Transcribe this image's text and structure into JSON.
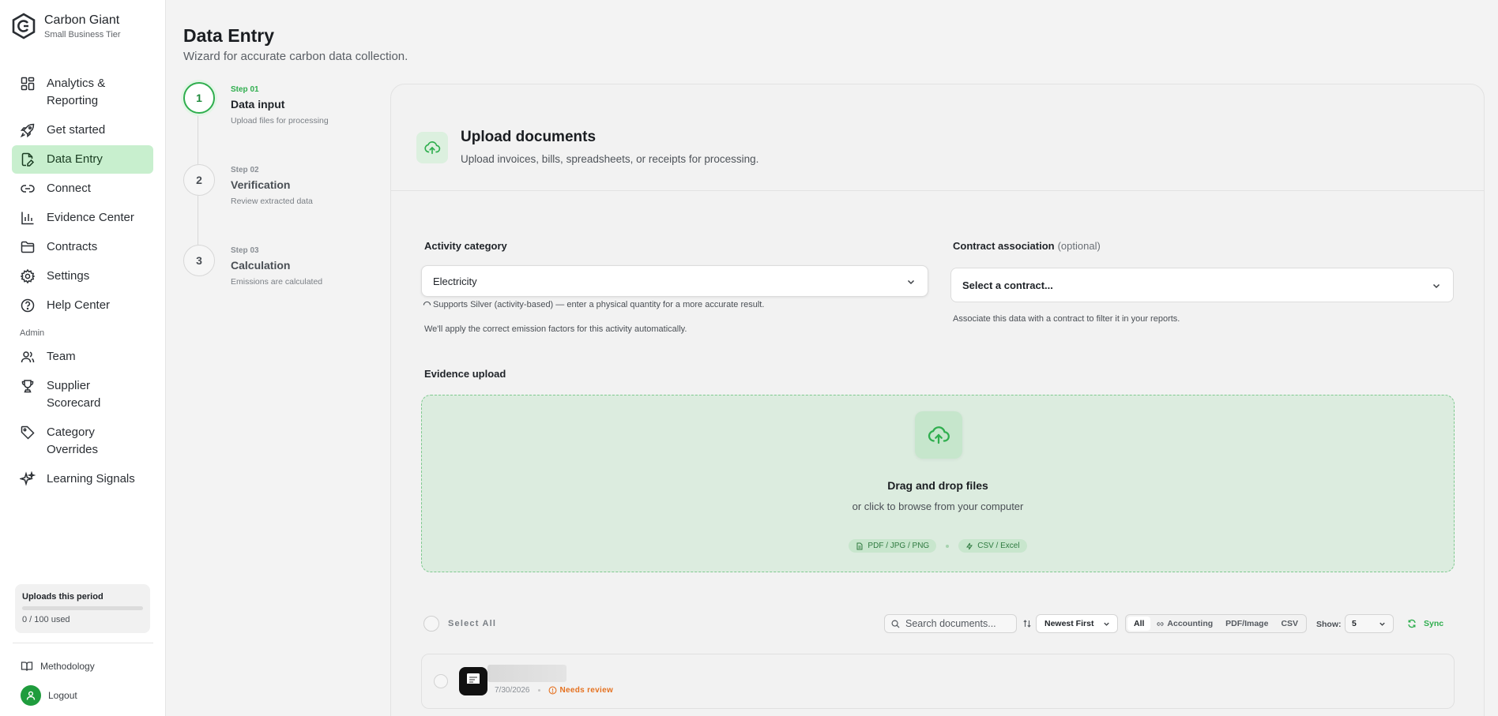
{
  "brand": {
    "name": "Carbon Giant",
    "tier": "Small Business Tier"
  },
  "nav": {
    "items": [
      {
        "label": "Analytics & Reporting",
        "icon": "dashboard-icon"
      },
      {
        "label": "Get started",
        "icon": "rocket-icon"
      },
      {
        "label": "Data Entry",
        "icon": "file-edit-icon",
        "active": true
      },
      {
        "label": "Connect",
        "icon": "link-icon"
      },
      {
        "label": "Evidence Center",
        "icon": "bar-chart-icon"
      },
      {
        "label": "Contracts",
        "icon": "folder-icon"
      },
      {
        "label": "Settings",
        "icon": "gear-icon"
      },
      {
        "label": "Help Center",
        "icon": "help-circle-icon"
      }
    ],
    "admin_section": "Admin",
    "admin_items": [
      {
        "label": "Team",
        "icon": "users-icon"
      },
      {
        "label": "Supplier Scorecard",
        "icon": "trophy-icon"
      },
      {
        "label": "Category Overrides",
        "icon": "tag-icon"
      },
      {
        "label": "Learning Signals",
        "icon": "sparkles-icon"
      }
    ]
  },
  "usage": {
    "title": "Uploads this period",
    "used_text": "0 / 100 used",
    "fraction": 0.0
  },
  "footer": {
    "methodology": "Methodology",
    "logout": "Logout"
  },
  "page": {
    "title": "Data Entry",
    "subtitle": "Wizard for accurate carbon data collection."
  },
  "steps": [
    {
      "number": "1",
      "kicker": "Step 01",
      "title": "Data input",
      "desc": "Upload files for processing",
      "active": true
    },
    {
      "number": "2",
      "kicker": "Step 02",
      "title": "Verification",
      "desc": "Review extracted data"
    },
    {
      "number": "3",
      "kicker": "Step 03",
      "title": "Calculation",
      "desc": "Emissions are calculated"
    }
  ],
  "upload": {
    "title": "Upload documents",
    "subtitle": "Upload invoices, bills, spreadsheets, or receipts for processing."
  },
  "activity": {
    "label": "Activity category",
    "value": "Electricity",
    "hint1": "Supports Silver (activity-based) — enter a physical quantity for a more accurate result.",
    "hint2": "We'll apply the correct emission factors for this activity automatically."
  },
  "contract": {
    "label": "Contract association",
    "optional": "(optional)",
    "placeholder": "Select a contract...",
    "hint": "Associate this data with a contract to filter it in your reports."
  },
  "evidence": {
    "label": "Evidence upload",
    "drop_title": "Drag and drop files",
    "drop_sub": "or click to browse from your computer",
    "tag_images": "PDF / JPG / PNG",
    "tag_sheets": "CSV / Excel"
  },
  "toolbar": {
    "select_all": "Select All",
    "search_placeholder": "Search documents...",
    "sort": "Newest First",
    "filters": [
      "All",
      "Accounting",
      "PDF/Image",
      "CSV"
    ],
    "show_label": "Show:",
    "show_value": "5",
    "sync": "Sync"
  },
  "documents": [
    {
      "date": "7/30/2026",
      "status": "Needs review"
    }
  ],
  "colors": {
    "accent": "#2fae4e",
    "active_nav": "#c8efce",
    "warning": "#e5711f"
  }
}
